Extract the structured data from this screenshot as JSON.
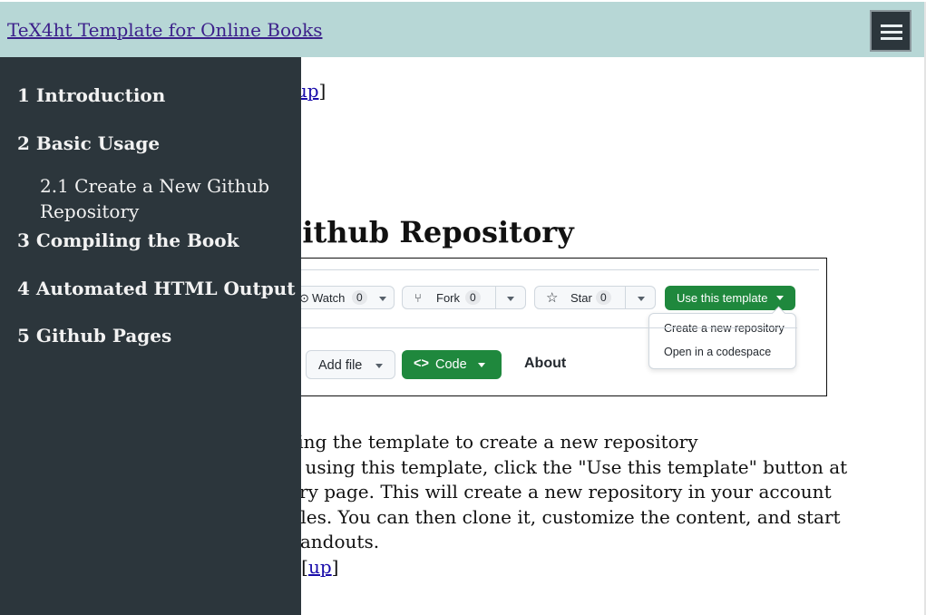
{
  "header": {
    "site_title": "TeX4ht Template for Online Books"
  },
  "nav_top": {
    "open": "[",
    "up": "up",
    "close": "]"
  },
  "section_heading": "Github Repository",
  "figure": {
    "watch_label": "Watch",
    "watch_count": "0",
    "fork_label": "Fork",
    "fork_count": "0",
    "star_label": "Star",
    "star_count": "0",
    "use_template_label": "Use this template",
    "dropdown": [
      "Create a new repository",
      "Open in a codespace"
    ],
    "add_file_label": "Add file",
    "code_label": "Code",
    "about_label": "About"
  },
  "body_lines": [
    "sing the template to create a new repository",
    "k using this template, click the \"Use this template\" button at",
    "ory page. This will create a new repository in your account",
    "files. You can then clone it, customize the content, and start",
    "handouts."
  ],
  "nav_bottom": {
    "prefix": "] [",
    "up": "up",
    "close": "]"
  },
  "sidebar": {
    "items": [
      "1 Introduction",
      "2 Basic Usage",
      "2.1 Create a New Github Repository",
      "3 Compiling the Book",
      "4 Automated HTML Output",
      "5 Github Pages"
    ]
  },
  "colors": {
    "header_bg": "#b7d7d6",
    "sidebar_bg": "#2c363c",
    "link": "#1a0dab",
    "github_green": "#1f883d"
  }
}
